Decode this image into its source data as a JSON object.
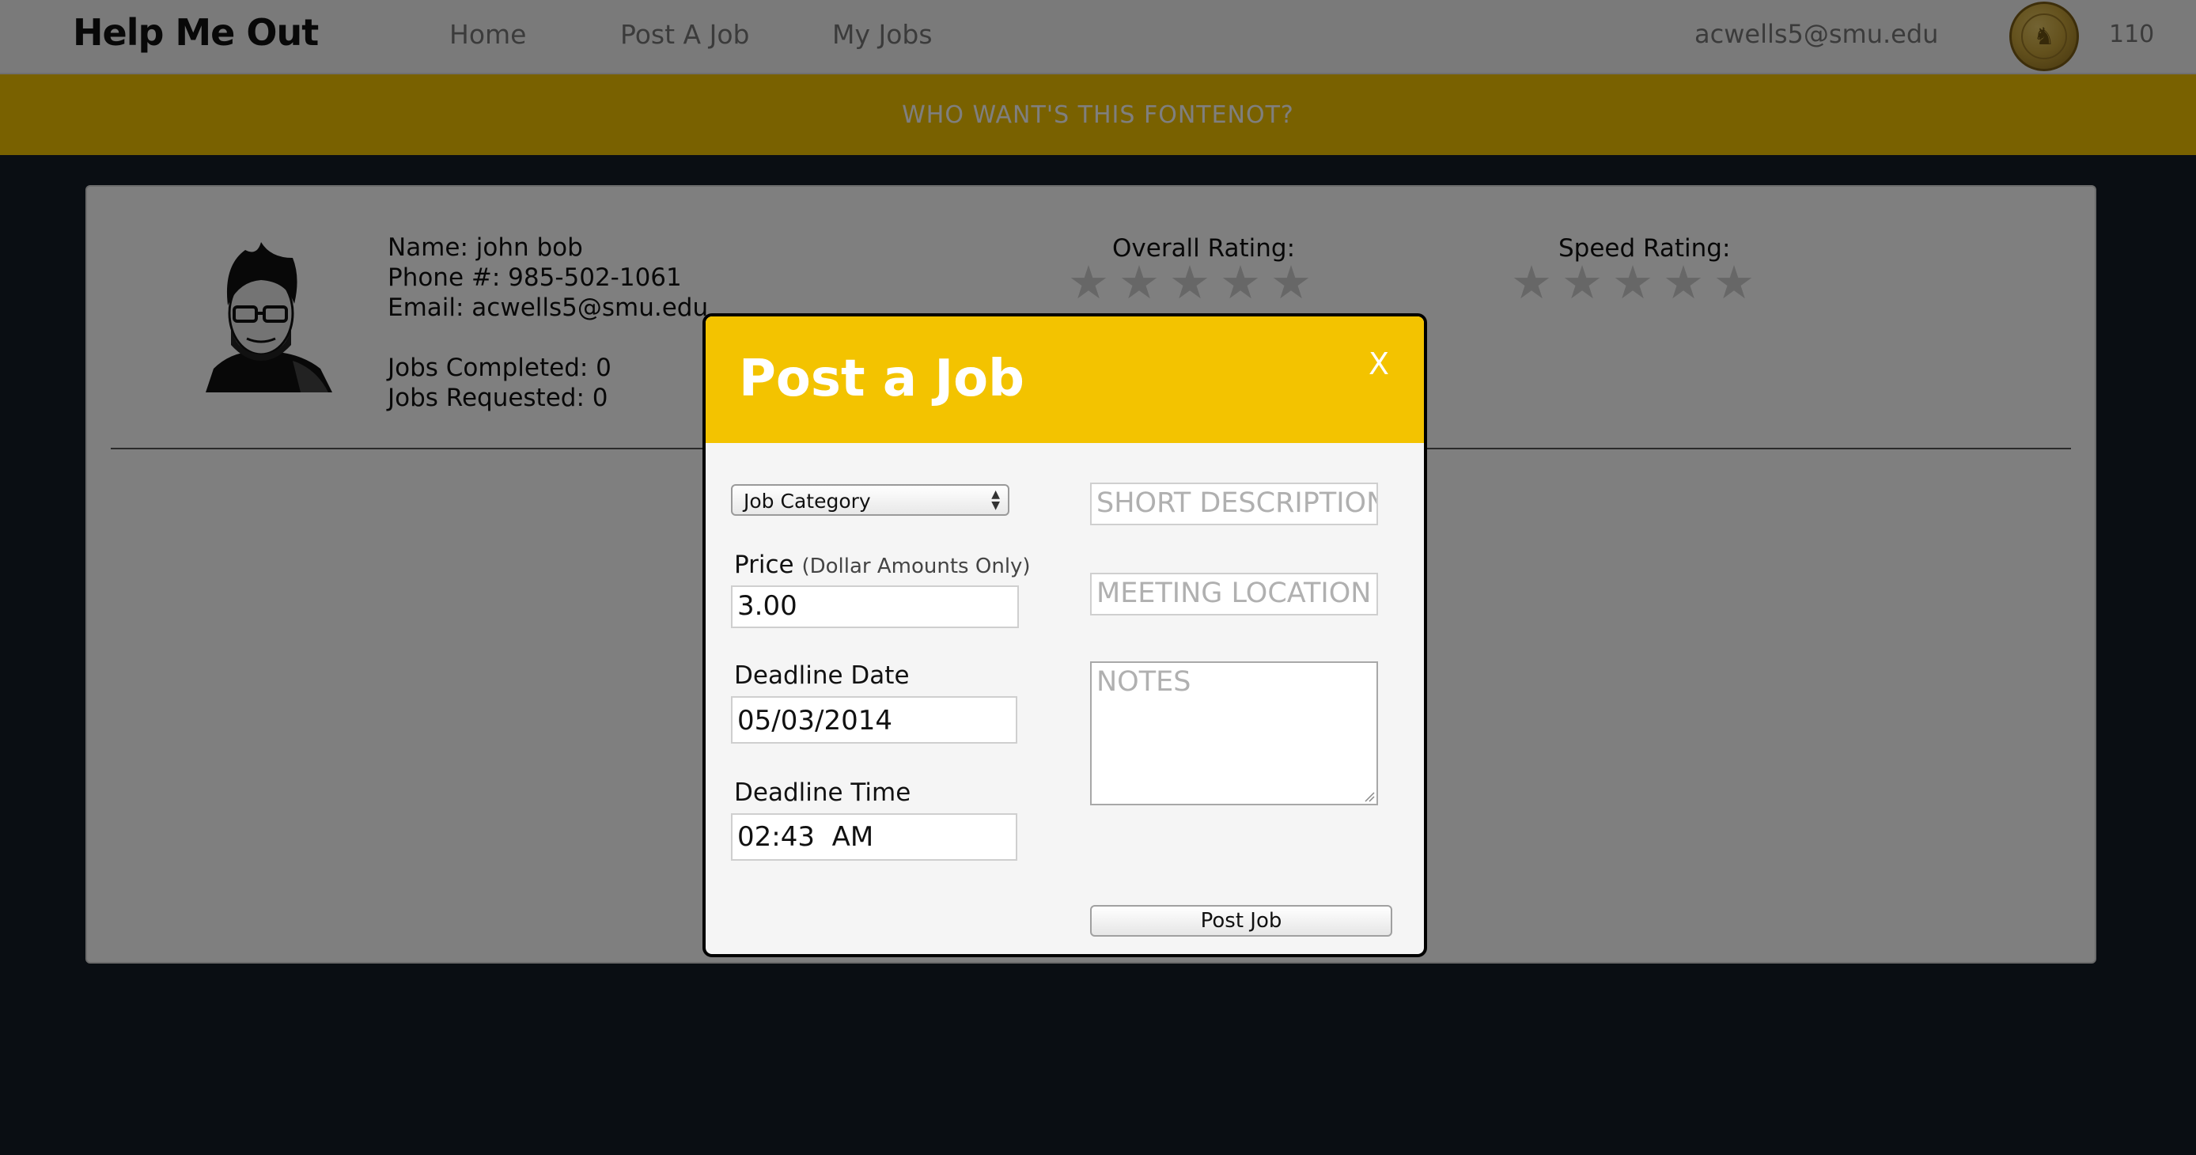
{
  "navbar": {
    "brand": "Help Me Out",
    "links": [
      "Home",
      "Post A Job",
      "My Jobs"
    ],
    "user_email": "acwells5@smu.edu",
    "coin_count": "110"
  },
  "banner": {
    "text": "WHO WANT'S THIS FONTENOT?"
  },
  "profile": {
    "name": "Name: john bob",
    "phone": "Phone #: 985-502-1061",
    "email": "Email: acwells5@smu.edu",
    "jobs_completed": "Jobs Completed: 0",
    "jobs_requested": "Jobs Requested: 0",
    "overall_label": "Overall Rating:",
    "speed_label": "Speed Rating:",
    "overall_rating": 0,
    "speed_rating": 0,
    "max_rating": 5
  },
  "modal": {
    "title": "Post a Job",
    "close": "X",
    "category_select": "Job Category",
    "price_label": "Price",
    "price_hint": "(Dollar Amounts Only)",
    "price_value": "3.00",
    "date_label": "Deadline Date",
    "date_value": "05/03/2014",
    "time_label": "Deadline Time",
    "time_value": "02:43  AM",
    "short_desc_placeholder": "SHORT DESCRIPTION",
    "meeting_placeholder": "MEETING LOCATION",
    "notes_placeholder": "NOTES",
    "submit": "Post Job"
  },
  "colors": {
    "accent": "#f3c300",
    "background": "#151c26",
    "card": "#ffffff"
  },
  "icons": {
    "star": "star-icon",
    "coin": "coin-icon",
    "avatar": "avatar-image"
  }
}
